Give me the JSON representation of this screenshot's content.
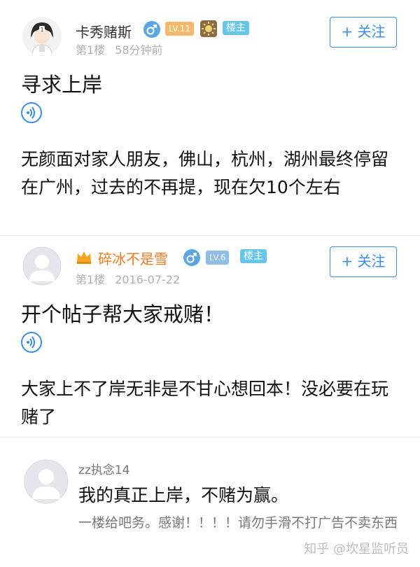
{
  "posts": [
    {
      "username": "卡秀赌斯",
      "level": "LV.11",
      "host_badge": "楼主",
      "floor": "第1楼",
      "time": "58分钟前",
      "follow_label": "+ 关注",
      "title": "寻求上岸",
      "body": "无颜面对家人朋友，佛山，杭州，湖州最终停留在广州，过去的不再提，现在欠10个左右"
    },
    {
      "username": "碎冰不是雪",
      "level": "LV.6",
      "host_badge": "楼主",
      "floor": "第1楼",
      "time": "2016-07-22",
      "follow_label": "+ 关注",
      "title": "开个帖子帮大家戒赌！",
      "body": "大家上不了岸无非是不甘心想回本！没必要在玩赌了"
    }
  ],
  "reply": {
    "username": "zz执念14",
    "main": "我的真正上岸，不赌为赢。",
    "note": "一楼给吧务。感谢！！！！请勿手滑不打广告不卖东西"
  },
  "watermark": "知乎 @坎星监听员",
  "icons": {
    "male": "male-symbol-icon",
    "voice": "voice-play-icon",
    "crown": "crown-icon",
    "sun_badge": "sun-medal-icon"
  },
  "colors": {
    "accent": "#3a8ee6",
    "vip_name": "#f47a20",
    "level_orange": "#f6b86b",
    "level_blue": "#8fbdea",
    "host_badge": "#66c6ea"
  }
}
